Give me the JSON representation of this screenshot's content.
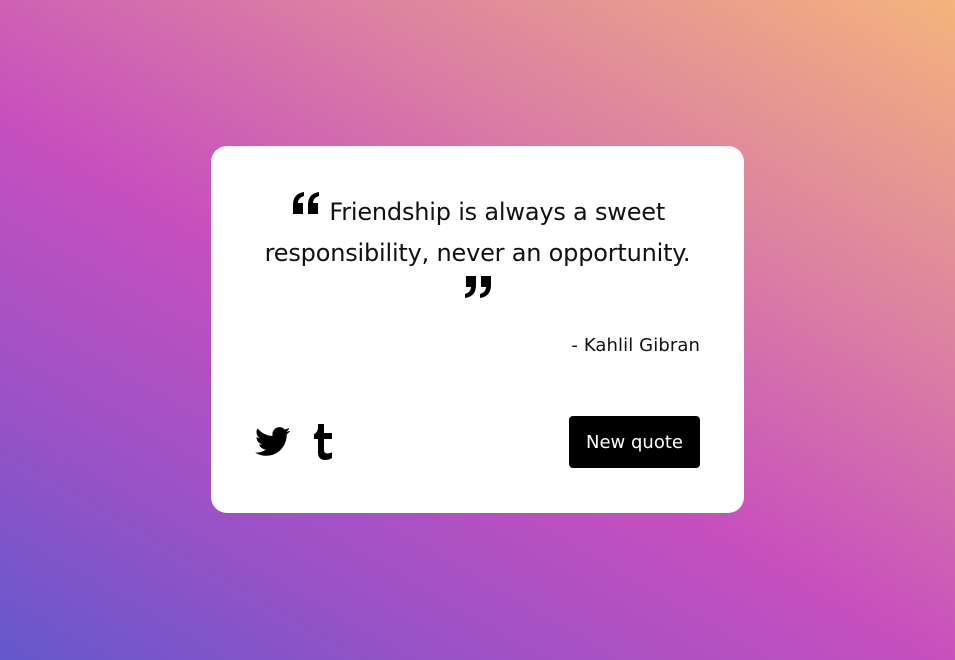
{
  "quote": {
    "text": "Friendship is always a sweet responsibility, never an opportunity.",
    "author": "- Kahlil Gibran",
    "open_mark_icon": "quote-left-icon",
    "close_mark_icon": "quote-right-icon"
  },
  "share": {
    "twitter_icon": "twitter-icon",
    "tumblr_icon": "tumblr-icon"
  },
  "actions": {
    "new_quote_label": "New quote"
  },
  "colors": {
    "card": "#ffffff",
    "button_bg": "#000000",
    "button_text": "#ffffff",
    "gradient_start": "#6458cc",
    "gradient_mid": "#c74fbe",
    "gradient_end": "#f4b47c"
  }
}
